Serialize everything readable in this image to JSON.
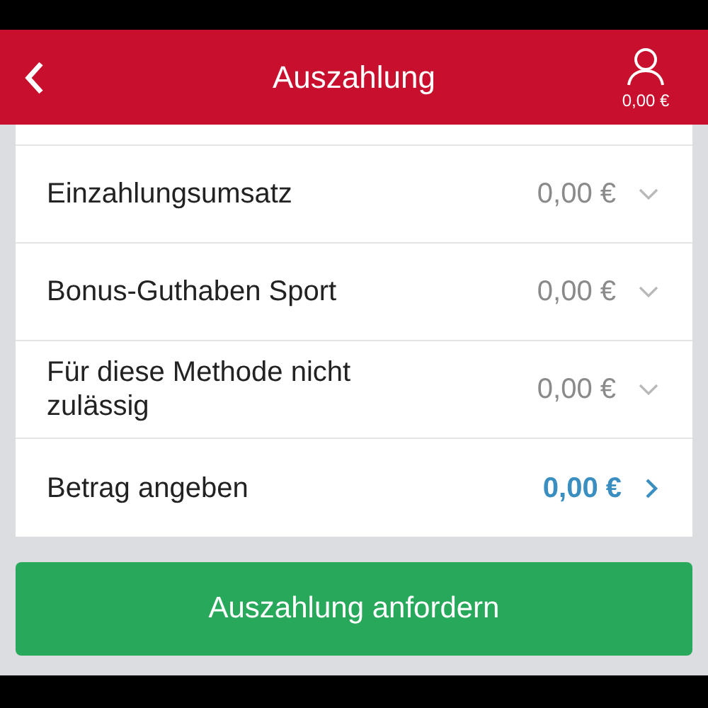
{
  "header": {
    "title": "Auszahlung",
    "balance": "0,00 €"
  },
  "rows": [
    {
      "label": "Einzahlungsumsatz",
      "value": "0,00 €",
      "kind": "breakdown"
    },
    {
      "label": "Bonus-Guthaben Sport",
      "value": "0,00 €",
      "kind": "breakdown"
    },
    {
      "label": "Für diese Methode nicht zulässig",
      "value": "0,00 €",
      "kind": "breakdown"
    },
    {
      "label": "Betrag angeben",
      "value": "0,00 €",
      "kind": "input"
    }
  ],
  "button": "Auszahlung anfordern"
}
